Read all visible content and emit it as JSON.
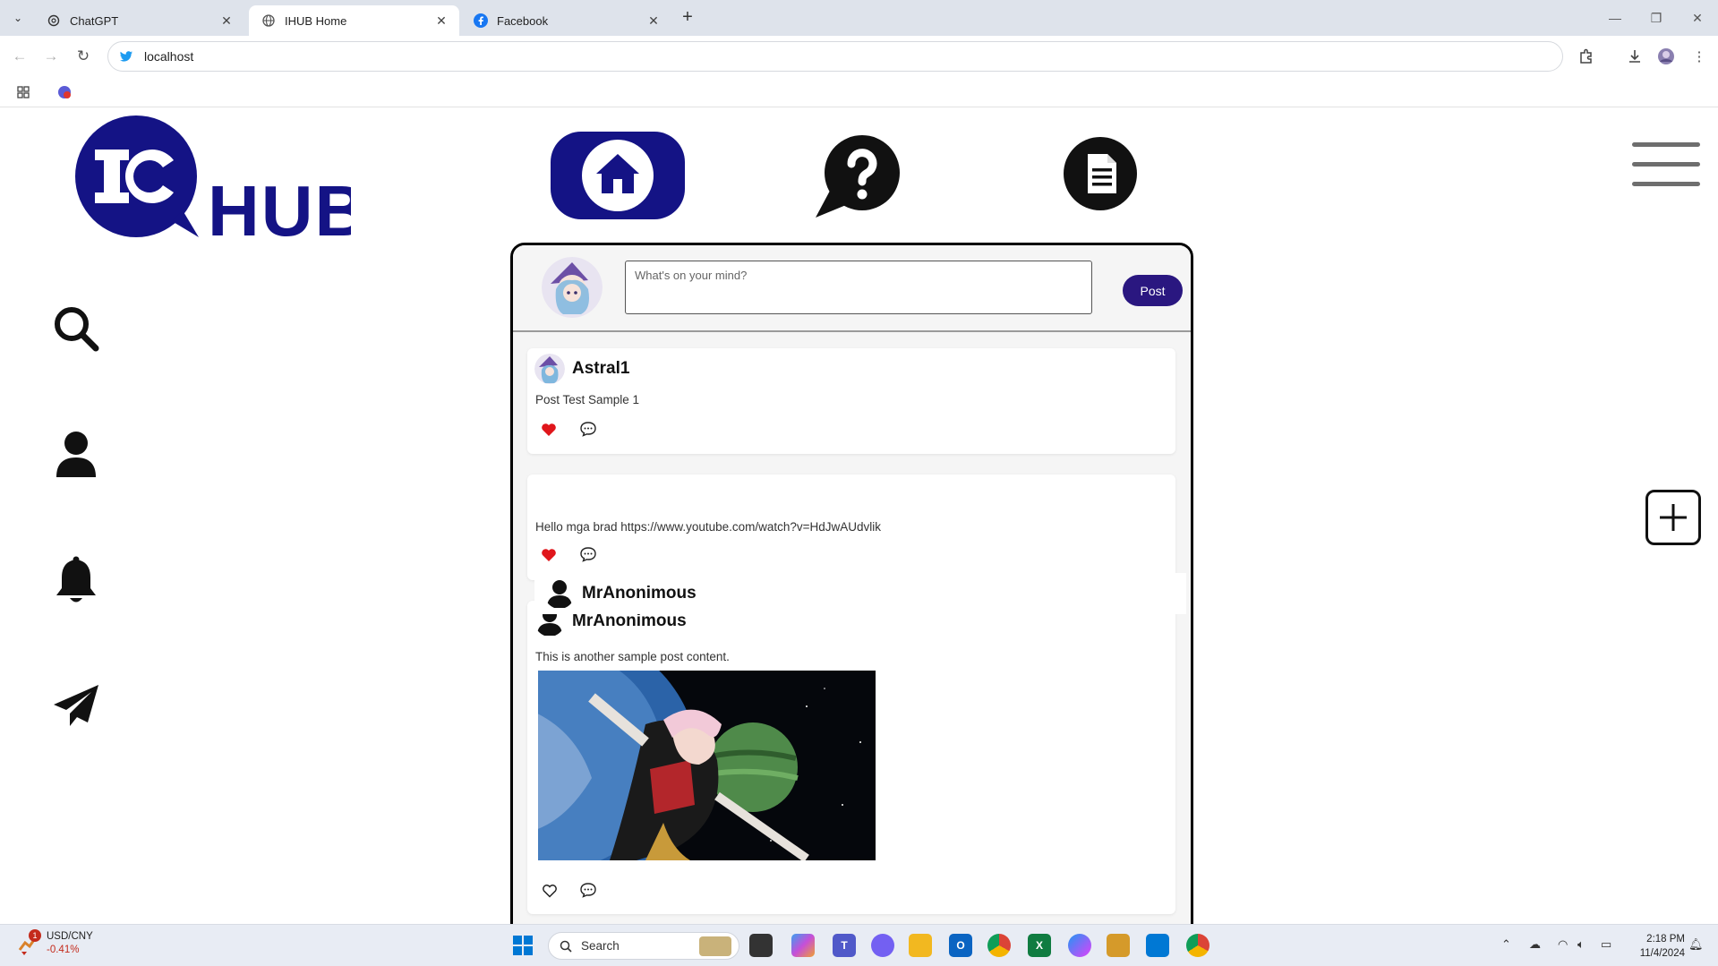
{
  "browser": {
    "tabs": [
      {
        "label": "ChatGPT",
        "active": false
      },
      {
        "label": "IHUB Home",
        "active": true
      },
      {
        "label": "Facebook",
        "active": false
      }
    ],
    "address": "localhost"
  },
  "page": {
    "logo_text": "HUB",
    "composer": {
      "placeholder": "What's on your mind?",
      "post_label": "Post"
    },
    "posts": [
      {
        "author": "Astral1",
        "text": "Post Test Sample 1",
        "liked": true
      },
      {
        "author": "MrAnonimous",
        "text": "Hello mga brad https://www.youtube.com/watch?v=HdJwAUdvlik",
        "liked": true
      },
      {
        "author": "MrAnonimous",
        "text": "This is another sample post content.",
        "liked": false
      }
    ]
  },
  "taskbar": {
    "widget_title": "USD/CNY",
    "widget_value": "-0.41%",
    "widget_badge": "1",
    "search_label": "Search",
    "time": "2:18 PM",
    "date": "11/4/2024"
  },
  "colors": {
    "brand_navy": "#141385",
    "post_button": "#2a1780",
    "like_red": "#e0161b"
  }
}
